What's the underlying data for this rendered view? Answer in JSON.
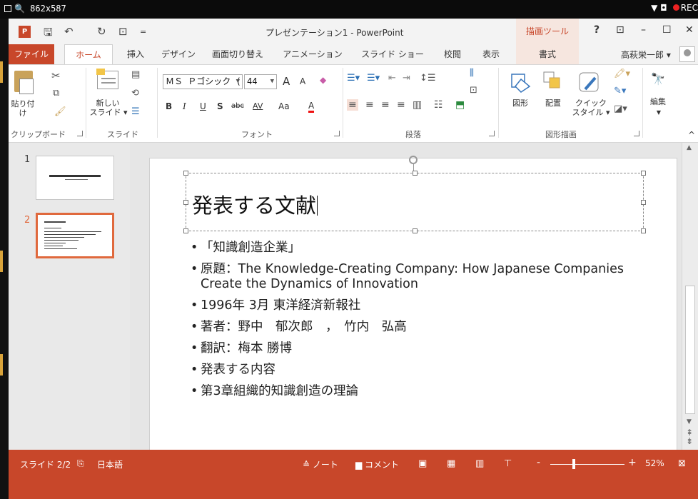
{
  "recorder": {
    "dims": "862x587",
    "rec_label": "REC"
  },
  "titlebar": {
    "doc_title": "プレゼンテーション1 - PowerPoint",
    "contextual_group": "描画ツール",
    "help": "?",
    "ribbon_display": "⊡",
    "minimize": "–",
    "maximize": "☐",
    "close": "✕",
    "qa_save": "🖫",
    "qa_undo": "↶",
    "qa_redo": "↻",
    "qa_presentation": "⊡",
    "qa_more": "="
  },
  "tabs": [
    {
      "label": "ファイル"
    },
    {
      "label": "ホーム"
    },
    {
      "label": "挿入"
    },
    {
      "label": "デザイン"
    },
    {
      "label": "画面切り替え"
    },
    {
      "label": "アニメーション"
    },
    {
      "label": "スライド ショー"
    },
    {
      "label": "校閲"
    },
    {
      "label": "表示"
    },
    {
      "label": "書式"
    }
  ],
  "user": {
    "name": "高萩栄一郎 ▾"
  },
  "ribbon": {
    "clipboard": {
      "paste": "貼り付け",
      "group": "クリップボード"
    },
    "slides": {
      "new_slide_1": "新しい",
      "new_slide_2": "スライド ▾",
      "group": "スライド"
    },
    "font": {
      "font_name": "ＭＳ Ｐゴシック (",
      "font_size": "44",
      "grow": "A",
      "shrink": "A",
      "bold": "B",
      "italic": "I",
      "underline": "U",
      "shadow": "S",
      "strike": "abc",
      "spacing": "AV",
      "case": "Aa",
      "color": "A",
      "group": "フォント"
    },
    "paragraph": {
      "group": "段落"
    },
    "drawing": {
      "shapes": "図形",
      "arrange": "配置",
      "quick_style_1": "クイック",
      "quick_style_2": "スタイル ▾",
      "group": "図形描画"
    },
    "editing": {
      "label": "編集"
    },
    "collapse": "^"
  },
  "thumbnails": [
    {
      "number": "1"
    },
    {
      "number": "2"
    }
  ],
  "slide": {
    "title": "発表する文献",
    "bullets": [
      "「知識創造企業」",
      "原題：The Knowledge-Creating Company: How Japanese Companies Create the Dynamics of Innovation",
      "1996年 3月 東洋経済新報社",
      "著者：野中　郁次郎　，　竹内　弘高",
      "翻訳：梅本 勝博",
      "発表する内容",
      "第3章組織的知識創造の理論"
    ]
  },
  "statusbar": {
    "slide_of": "スライド 2/2",
    "language": "日本語",
    "notes": "≙ ノート",
    "comments": "▆ コメント",
    "minus": "-",
    "plus": "+",
    "zoom": "52%",
    "zoom_level": 52
  },
  "colors": {
    "accent": "#c8472a",
    "selection": "#e0693d"
  }
}
